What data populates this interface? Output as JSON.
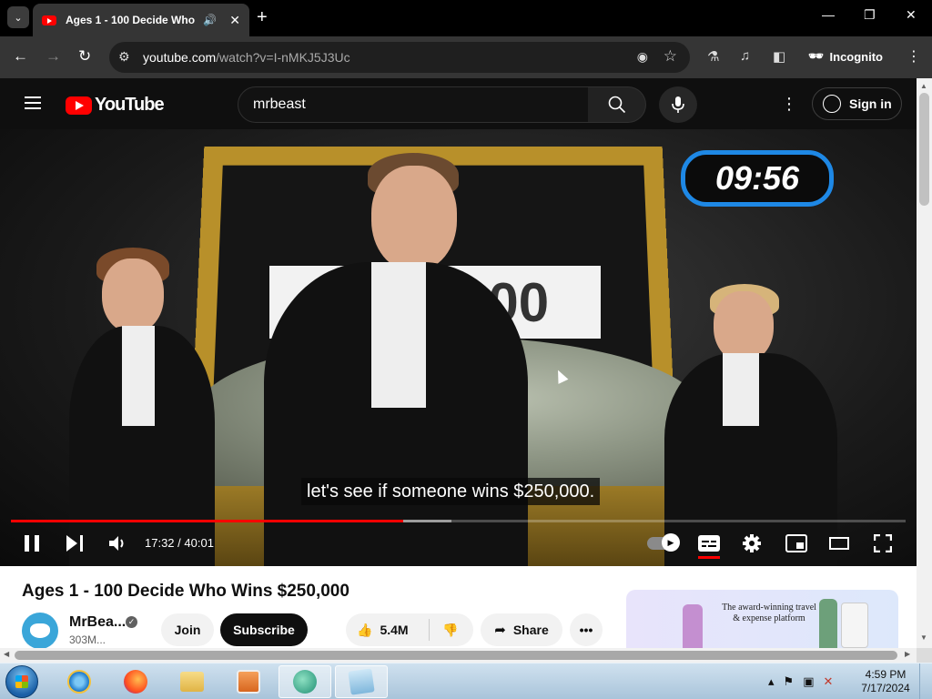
{
  "browser": {
    "tab_title": "Ages 1 - 100 Decide Who Wins $250,000",
    "url_host": "youtube.com",
    "url_path": "/watch?v=I-nMKJ5J3Uc",
    "profile_label": "Incognito"
  },
  "youtube": {
    "logo_text": "YouTube",
    "search_query": "mrbeast",
    "sign_in_label": "Sign in"
  },
  "video": {
    "timer_overlay": "09:56",
    "sign_text": "$250,000",
    "caption": "let's see if someone wins $250,000.",
    "current_time": "17:32",
    "duration": "40:01",
    "time_separator": " / ",
    "played_fraction": 0.438,
    "buffered_fraction": 0.492
  },
  "meta": {
    "title": "Ages 1 - 100 Decide Who Wins $250,000",
    "channel_name": "MrBea...",
    "subscribers": "303M...",
    "join_label": "Join",
    "subscribe_label": "Subscribe",
    "like_count": "5.4M",
    "share_label": "Share"
  },
  "ad": {
    "text": "The award-winning travel & expense platform"
  },
  "taskbar": {
    "time": "4:59 PM",
    "date": "7/17/2024"
  },
  "colors": {
    "youtube_red": "#ff0000",
    "timer_border": "#1e88e5",
    "frame_gold": "#b8902a"
  }
}
